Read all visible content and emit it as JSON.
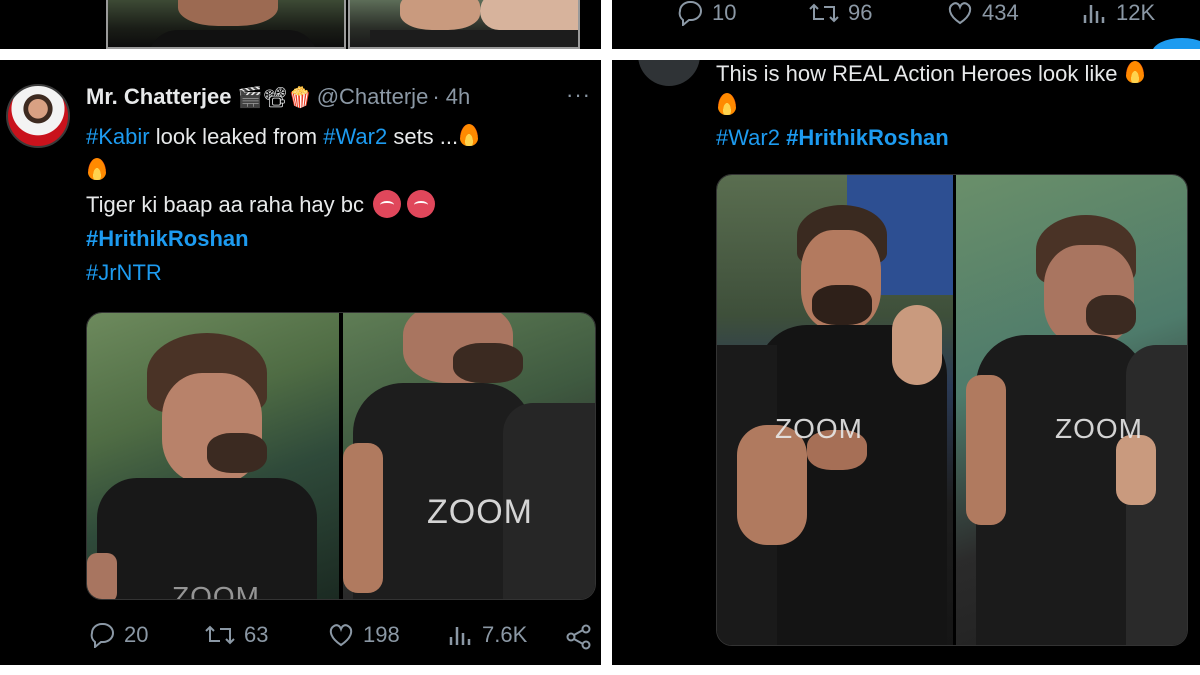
{
  "prev_tweet_left": {},
  "prev_tweet_right": {
    "replies": "10",
    "retweets": "96",
    "likes": "434",
    "views": "12K"
  },
  "tweet_left": {
    "display_name": "Mr. Chatterjee",
    "name_emojis": "🎬📽🍿",
    "handle": "@Chatterje",
    "time": "· 4h",
    "more": "···",
    "line1_tag1": "#Kabir",
    "line1_mid": " look leaked from ",
    "line1_tag2": "#War2",
    "line1_end": " sets ...",
    "line3": "Tiger ki baap aa raha hay bc",
    "tag_hrithik": "#HrithikRoshan",
    "tag_jrntr": "#JrNTR",
    "watermark": "ZOOM",
    "replies": "20",
    "retweets": "63",
    "likes": "198",
    "views": "7.6K"
  },
  "tweet_right": {
    "line1": "This is how REAL Action Heroes look like",
    "tag_war2": "#War2",
    "tag_hrithik": "#HrithikRoshan",
    "watermark_left": "ZOOM",
    "watermark_right": "ZOOM"
  },
  "colors": {
    "background": "#000000",
    "text": "#e7e9ea",
    "muted": "#8b98a5",
    "accent": "#1d9bf0"
  },
  "icons": [
    "reply-icon",
    "retweet-icon",
    "like-icon",
    "views-icon",
    "share-icon"
  ]
}
